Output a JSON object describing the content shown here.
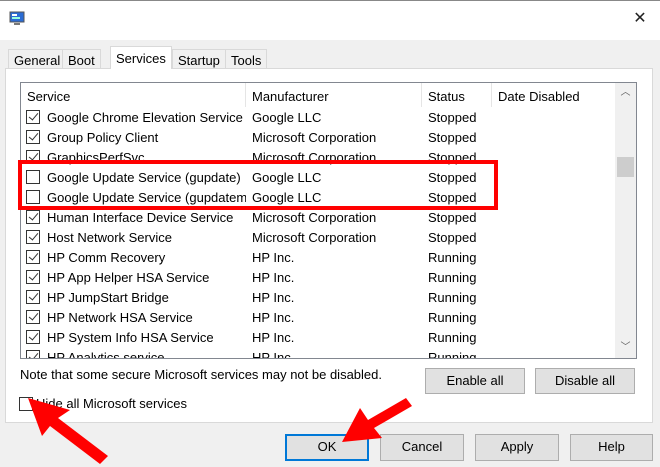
{
  "window": {
    "close_icon": "close-icon",
    "app_icon": "msconfig-icon"
  },
  "tabs": [
    {
      "label": "General"
    },
    {
      "label": "Boot"
    },
    {
      "label": "Services",
      "active": true
    },
    {
      "label": "Startup"
    },
    {
      "label": "Tools"
    }
  ],
  "table": {
    "columns": [
      "Service",
      "Manufacturer",
      "Status",
      "Date Disabled"
    ],
    "rows": [
      {
        "checked": true,
        "service": "Google Chrome Elevation Service",
        "manufacturer": "Google LLC",
        "status": "Stopped",
        "date": ""
      },
      {
        "checked": true,
        "service": "Group Policy Client",
        "manufacturer": "Microsoft Corporation",
        "status": "Stopped",
        "date": ""
      },
      {
        "checked": true,
        "service": "GraphicsPerfSvc",
        "manufacturer": "Microsoft Corporation",
        "status": "Stopped",
        "date": ""
      },
      {
        "checked": false,
        "service": "Google Update Service (gupdate)",
        "manufacturer": "Google LLC",
        "status": "Stopped",
        "date": ""
      },
      {
        "checked": false,
        "service": "Google Update Service (gupdatem)",
        "manufacturer": "Google LLC",
        "status": "Stopped",
        "date": ""
      },
      {
        "checked": true,
        "service": "Human Interface Device Service",
        "manufacturer": "Microsoft Corporation",
        "status": "Stopped",
        "date": ""
      },
      {
        "checked": true,
        "service": "Host Network Service",
        "manufacturer": "Microsoft Corporation",
        "status": "Stopped",
        "date": ""
      },
      {
        "checked": true,
        "service": "HP Comm Recovery",
        "manufacturer": "HP Inc.",
        "status": "Running",
        "date": ""
      },
      {
        "checked": true,
        "service": "HP App Helper HSA Service",
        "manufacturer": "HP Inc.",
        "status": "Running",
        "date": ""
      },
      {
        "checked": true,
        "service": "HP JumpStart Bridge",
        "manufacturer": "HP Inc.",
        "status": "Running",
        "date": ""
      },
      {
        "checked": true,
        "service": "HP Network HSA Service",
        "manufacturer": "HP Inc.",
        "status": "Running",
        "date": ""
      },
      {
        "checked": true,
        "service": "HP System Info HSA Service",
        "manufacturer": "HP Inc.",
        "status": "Running",
        "date": ""
      },
      {
        "checked": true,
        "service": "HP Analytics service",
        "manufacturer": "HP Inc.",
        "status": "Running",
        "date": ""
      }
    ]
  },
  "note": "Note that some secure Microsoft services may not be disabled.",
  "enable_all": "Enable all",
  "disable_all": "Disable all",
  "hide_ms": {
    "label": "Hide all Microsoft services",
    "checked": false
  },
  "buttons": {
    "ok": "OK",
    "cancel": "Cancel",
    "apply": "Apply",
    "help": "Help"
  },
  "annotation": {
    "color": "#ff0000"
  }
}
